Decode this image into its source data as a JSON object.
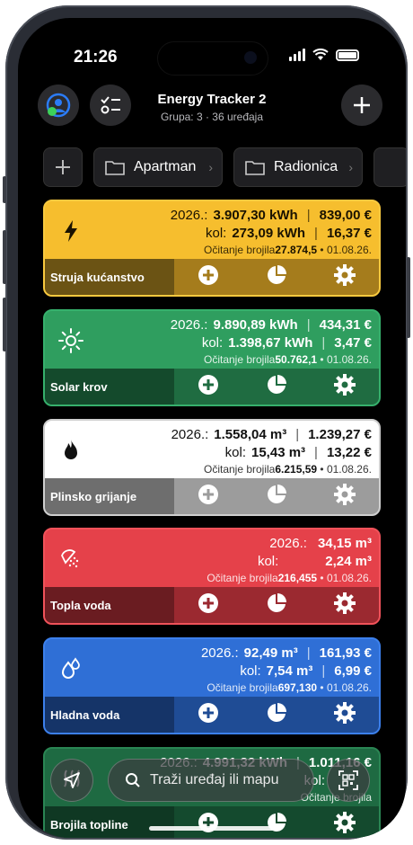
{
  "status": {
    "time": "21:26"
  },
  "header": {
    "title": "Energy Tracker 2",
    "subtitle": "Grupa: 3 · 36 uređaja"
  },
  "folders": [
    {
      "label": "Apartman"
    },
    {
      "label": "Radionica"
    }
  ],
  "devices": [
    {
      "name": "Struja kućanstvo",
      "icon": "lightning-icon",
      "year_label": "2026.:",
      "year_amount": "3.907,30 kWh",
      "year_cost": "839,00 €",
      "kol_label": "kol:",
      "kol_amount": "273,09 kWh",
      "kol_cost": "16,37 €",
      "meter_label": "Očitanje brojila",
      "meter_value": "27.874,5",
      "meter_date": " • 01.08.26.",
      "colors": {
        "top": "#F6BE2E",
        "bottom": "#A57C1C",
        "name_bg": "#6B5314",
        "border": "#F8C93F",
        "text": "#1a1200"
      }
    },
    {
      "name": "Solar krov",
      "icon": "sun-icon",
      "year_label": "2026.:",
      "year_amount": "9.890,89 kWh",
      "year_cost": "434,31 €",
      "kol_label": "kol:",
      "kol_amount": "1.398,67 kWh",
      "kol_cost": "3,47 €",
      "meter_label": "Očitanje brojila",
      "meter_value": "50.762,1",
      "meter_date": " • 01.08.26.",
      "colors": {
        "top": "#2F9E5F",
        "bottom": "#1F6C41",
        "name_bg": "#144A2C",
        "border": "#36B06C",
        "text": "#ffffff"
      }
    },
    {
      "name": "Plinsko grijanje",
      "icon": "flame-icon",
      "year_label": "2026.:",
      "year_amount": "1.558,04 m³",
      "year_cost": "1.239,27 €",
      "kol_label": "kol:",
      "kol_amount": "15,43 m³",
      "kol_cost": "13,22 €",
      "meter_label": "Očitanje brojila",
      "meter_value": "6.215,59",
      "meter_date": " • 01.08.26.",
      "colors": {
        "top": "#FFFFFF",
        "bottom": "#9C9C9C",
        "name_bg": "#6E6E6E",
        "border": "#CFCFCF",
        "text": "#111111"
      }
    },
    {
      "name": "Topla voda",
      "icon": "shower-icon",
      "year_label": "2026.:",
      "year_amount": "",
      "year_cost": "34,15 m³",
      "kol_label": "kol:",
      "kol_amount": "",
      "kol_cost": "2,24 m³",
      "meter_label": "Očitanje brojila",
      "meter_value": "216,455",
      "meter_date": " • 01.08.26.",
      "colors": {
        "top": "#E5414A",
        "bottom": "#9B2930",
        "name_bg": "#6A1C21",
        "border": "#F0525A",
        "text": "#ffffff"
      }
    },
    {
      "name": "Hladna voda",
      "icon": "droplets-icon",
      "year_label": "2026.:",
      "year_amount": "92,49 m³",
      "year_cost": "161,93 €",
      "kol_label": "kol:",
      "kol_amount": "7,54 m³",
      "kol_cost": "6,99 €",
      "meter_label": "Očitanje brojila",
      "meter_value": "697,130",
      "meter_date": " • 01.08.26.",
      "colors": {
        "top": "#2F6FD6",
        "bottom": "#1F4C95",
        "name_bg": "#153468",
        "border": "#3C80EC",
        "text": "#ffffff"
      }
    },
    {
      "name": "Brojila topline",
      "icon": "heat-icon",
      "year_label": "2026.:",
      "year_amount": "4.991,32 kWh",
      "year_cost": "1.011,16 €",
      "kol_label": "kol:",
      "kol_amount": "",
      "kol_cost": "",
      "meter_label": "Očitanje brojila",
      "meter_value": "",
      "meter_date": "",
      "colors": {
        "top": "#1E6A42",
        "bottom": "#144A2E",
        "name_bg": "#0F3823",
        "border": "#2A8553",
        "text": "#ffffff"
      }
    }
  ],
  "search": {
    "placeholder": "Traži uređaj ili mapu"
  }
}
